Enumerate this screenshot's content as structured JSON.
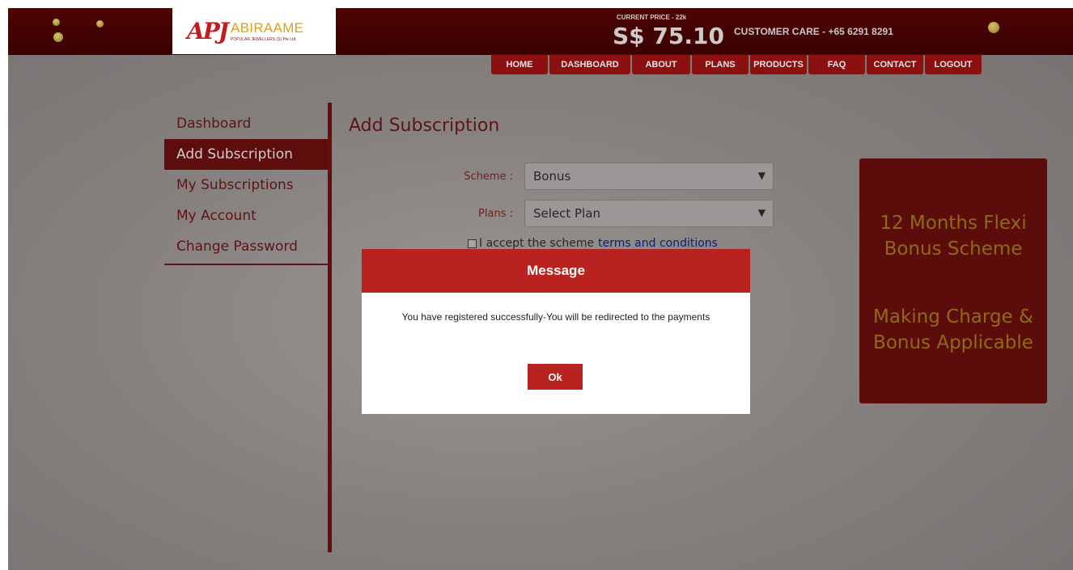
{
  "header": {
    "logo_mark": "APJ",
    "logo_name": "ABIRAAME",
    "logo_subtitle": "POPULAR JEWELLERS (S) Pte Ltd",
    "price_label": "CURRENT PRICE - 22k",
    "price_value": "S$ 75.10",
    "customer_care": "CUSTOMER CARE - +65 6291 8291"
  },
  "nav": [
    "HOME",
    "DASHBOARD",
    "ABOUT",
    "PLANS",
    "PRODUCTS",
    "FAQ",
    "CONTACT",
    "LOGOUT"
  ],
  "sidebar": {
    "items": [
      {
        "label": "Dashboard"
      },
      {
        "label": "Add Subscription",
        "active": true
      },
      {
        "label": "My Subscriptions"
      },
      {
        "label": "My Account"
      },
      {
        "label": "Change Password"
      }
    ]
  },
  "main": {
    "title": "Add Subscription",
    "scheme_label": "Scheme :",
    "scheme_value": "Bonus",
    "plans_label": "Plans :",
    "plans_value": "Select Plan",
    "terms_text": "I accept the scheme",
    "terms_link": "terms and conditions"
  },
  "promo": {
    "line1": "12 Months Flexi",
    "line2": "Bonus Scheme",
    "line3": "Making Charge &",
    "line4": "Bonus Applicable"
  },
  "modal": {
    "title": "Message",
    "message": "You have registered successfully-You will be redirected to the payments",
    "ok_label": "Ok"
  },
  "colors": {
    "header_bg": "#4d0404",
    "nav_bg": "#8c1010",
    "modal_accent": "#b8231f",
    "promo_bg": "#5d0c0c",
    "promo_text": "#8c6b16"
  }
}
